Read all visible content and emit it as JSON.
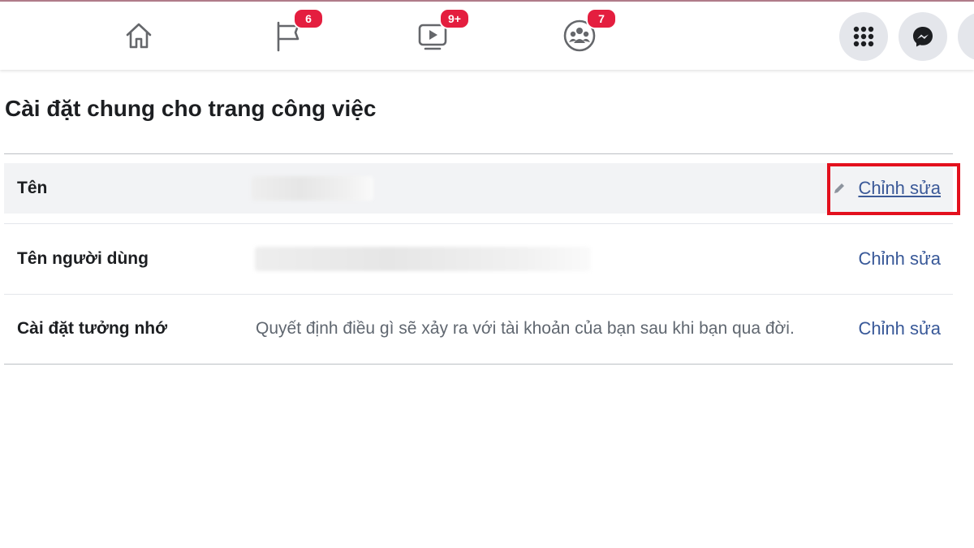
{
  "nav": {
    "tabs": [
      {
        "name": "home",
        "badge": ""
      },
      {
        "name": "pages",
        "badge": "6"
      },
      {
        "name": "watch",
        "badge": "9+"
      },
      {
        "name": "groups",
        "badge": "7"
      }
    ],
    "badge_color": "#e41e3f"
  },
  "page_title": "Cài đặt chung cho trang công việc",
  "rows": [
    {
      "label": "Tên",
      "value": "",
      "edit": "Chỉnh sửa"
    },
    {
      "label": "Tên người dùng",
      "value": "",
      "edit": "Chỉnh sửa"
    },
    {
      "label": "Cài đặt tưởng nhớ",
      "value": "Quyết định điều gì sẽ xảy ra với tài khoản của bạn sau khi bạn qua đời.",
      "edit": "Chỉnh sửa"
    }
  ],
  "colors": {
    "link": "#385898",
    "highlight_row": "#f2f3f5",
    "annotation_box": "#e3101d"
  }
}
